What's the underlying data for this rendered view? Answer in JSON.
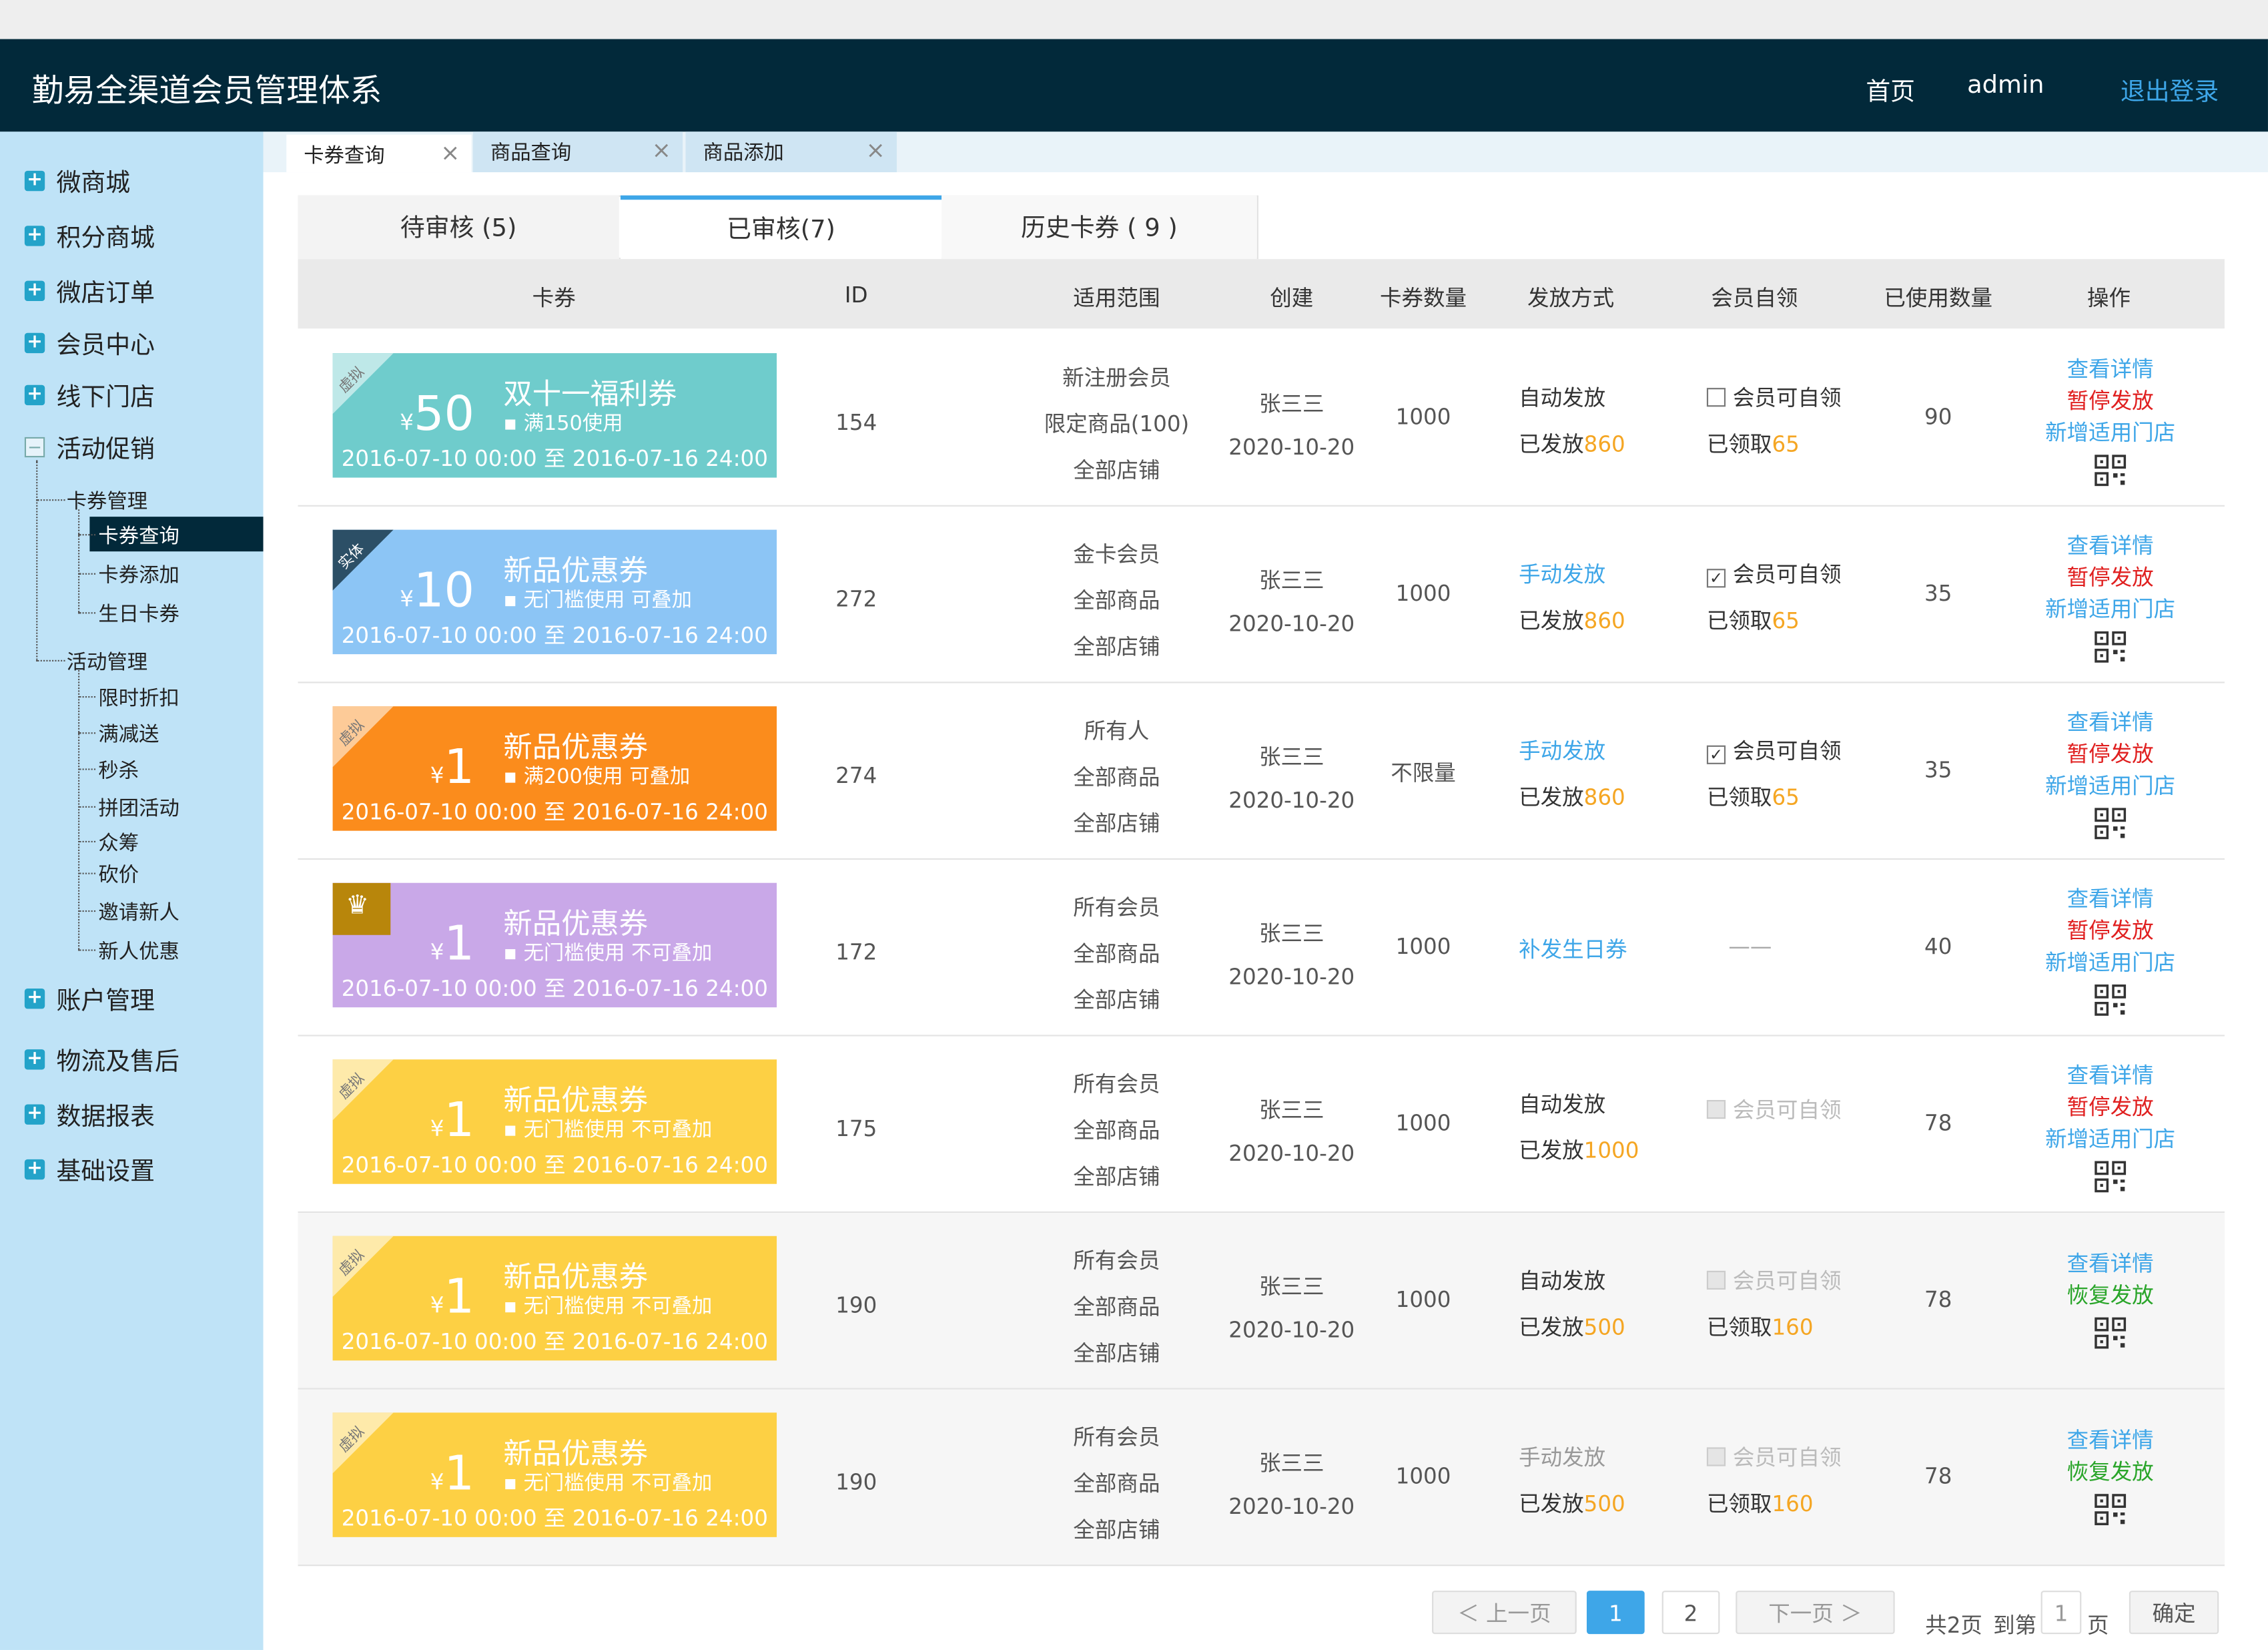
{
  "header": {
    "app_title": "勤易全渠道会员管理体系",
    "home": "首页",
    "user": "admin",
    "logout": "退出登录"
  },
  "sidebar": {
    "menus": [
      "微商城",
      "积分商城",
      "微店订单",
      "会员中心",
      "线下门店",
      "活动促销",
      "账户管理",
      "物流及售后",
      "数据报表",
      "基础设置"
    ],
    "group_card": "卡券管理",
    "card_items": [
      "卡券查询",
      "卡券添加",
      "生日卡券"
    ],
    "group_activity": "活动管理",
    "activity_items": [
      "限时折扣",
      "满减送",
      "秒杀",
      "拼团活动",
      "众筹",
      "砍价",
      "邀请新人",
      "新人优惠"
    ]
  },
  "page_tabs": [
    {
      "label": "卡券查询"
    },
    {
      "label": "商品查询"
    },
    {
      "label": "商品添加"
    }
  ],
  "sub_tabs": [
    {
      "label": "待审核 (5)"
    },
    {
      "label": "已审核(7)"
    },
    {
      "label": "历史卡券 ( 9 )"
    }
  ],
  "columns": [
    "卡券",
    "ID",
    "适用范围",
    "创建",
    "卡券数量",
    "发放方式",
    "会员自领",
    "已使用数量",
    "操作"
  ],
  "rows": [
    {
      "tag": "虚拟",
      "color": "#6fcccc",
      "currency": "¥",
      "amount": "50",
      "name": "双十一福利券",
      "cond": "▪ 满150使用",
      "date": "2016-07-10  00:00 至 2016-07-16  24:00",
      "id": "154",
      "scope": [
        "新注册会员",
        "限定商品(100)",
        "全部店铺"
      ],
      "creator": "张三三",
      "created": "2020-10-20",
      "qty": "1000",
      "issue": "自动发放",
      "issued_prefix": "已发放",
      "issued": "860",
      "self": "会员可自领",
      "self_check": "",
      "claimed_prefix": "已领取",
      "claimed": "65",
      "used": "90",
      "ops": [
        "查看详情",
        "暂停发放",
        "新增适用门店"
      ]
    },
    {
      "tag": "实体",
      "color": "#8cc5f5",
      "currency": "¥",
      "amount": "10",
      "name": "新品优惠券",
      "cond": "▪ 无门槛使用  可叠加",
      "date": "2016-07-10  00:00 至 2016-07-16  24:00",
      "id": "272",
      "scope": [
        "金卡会员",
        "全部商品",
        "全部店铺"
      ],
      "creator": "张三三",
      "created": "2020-10-20",
      "qty": "1000",
      "issue": "手动发放",
      "issued_prefix": "已发放",
      "issued": "860",
      "self": "会员可自领",
      "self_check": "✓",
      "claimed_prefix": "已领取",
      "claimed": "65",
      "used": "35",
      "ops": [
        "查看详情",
        "暂停发放",
        "新增适用门店"
      ]
    },
    {
      "tag": "虚拟",
      "color": "#fb8c1c",
      "currency": "¥",
      "amount": "1",
      "name": "新品优惠券",
      "cond": "▪ 满200使用  可叠加",
      "date": "2016-07-10  00:00 至 2016-07-16  24:00",
      "id": "274",
      "scope": [
        "所有人",
        "全部商品",
        "全部店铺"
      ],
      "creator": "张三三",
      "created": "2020-10-20",
      "qty": "不限量",
      "issue": "手动发放",
      "issued_prefix": "已发放",
      "issued": "860",
      "self": "会员可自领",
      "self_check": "✓",
      "claimed_prefix": "已领取",
      "claimed": "65",
      "used": "35",
      "ops": [
        "查看详情",
        "暂停发放",
        "新增适用门店"
      ]
    },
    {
      "tag": "crown",
      "color": "#c9a8e8",
      "currency": "¥",
      "amount": "1",
      "name": "新品优惠券",
      "cond": "▪ 无门槛使用  不可叠加",
      "date": "2016-07-10  00:00 至 2016-07-16  24:00",
      "id": "172",
      "scope": [
        "所有会员",
        "全部商品",
        "全部店铺"
      ],
      "creator": "张三三",
      "created": "2020-10-20",
      "qty": "1000",
      "issue": "补发生日券",
      "issued_prefix": "",
      "issued": "",
      "self": "——",
      "self_check": "",
      "claimed_prefix": "",
      "claimed": "",
      "used": "40",
      "ops": [
        "查看详情",
        "暂停发放",
        "新增适用门店"
      ]
    },
    {
      "tag": "虚拟",
      "color": "#fdd044",
      "currency": "¥",
      "amount": "1",
      "name": "新品优惠券",
      "cond": "▪ 无门槛使用  不可叠加",
      "date": "2016-07-10  00:00 至 2016-07-16  24:00",
      "id": "175",
      "scope": [
        "所有会员",
        "全部商品",
        "全部店铺"
      ],
      "creator": "张三三",
      "created": "2020-10-20",
      "qty": "1000",
      "issue": "自动发放",
      "issued_prefix": "已发放",
      "issued": "1000",
      "self": "会员可自领",
      "self_check": "",
      "claimed_prefix": "",
      "claimed": "",
      "used": "78",
      "ops": [
        "查看详情",
        "暂停发放",
        "新增适用门店"
      ]
    },
    {
      "tag": "虚拟",
      "color": "#fdd044",
      "currency": "¥",
      "amount": "1",
      "name": "新品优惠券",
      "cond": "▪ 无门槛使用  不可叠加",
      "date": "2016-07-10  00:00 至 2016-07-16  24:00",
      "id": "190",
      "scope": [
        "所有会员",
        "全部商品",
        "全部店铺"
      ],
      "creator": "张三三",
      "created": "2020-10-20",
      "qty": "1000",
      "issue": "自动发放",
      "issued_prefix": "已发放",
      "issued": "500",
      "self": "会员可自领",
      "self_check": "",
      "claimed_prefix": "已领取",
      "claimed": "160",
      "used": "78",
      "ops": [
        "查看详情",
        "恢复发放"
      ]
    },
    {
      "tag": "虚拟",
      "color": "#fdd044",
      "currency": "¥",
      "amount": "1",
      "name": "新品优惠券",
      "cond": "▪ 无门槛使用  不可叠加",
      "date": "2016-07-10  00:00 至 2016-07-16  24:00",
      "id": "190",
      "scope": [
        "所有会员",
        "全部商品",
        "全部店铺"
      ],
      "creator": "张三三",
      "created": "2020-10-20",
      "qty": "1000",
      "issue": "手动发放",
      "issued_prefix": "已发放",
      "issued": "500",
      "self": "会员可自领",
      "self_check": "",
      "claimed_prefix": "已领取",
      "claimed": "160",
      "used": "78",
      "ops": [
        "查看详情",
        "恢复发放"
      ]
    }
  ],
  "pagination": {
    "prev": "＜ 上一页",
    "pages": [
      "1",
      "2"
    ],
    "next": "下一页 ＞",
    "total": "共2页",
    "goto": "到第",
    "page_input": "1",
    "page_unit": "页",
    "confirm": "确定"
  }
}
